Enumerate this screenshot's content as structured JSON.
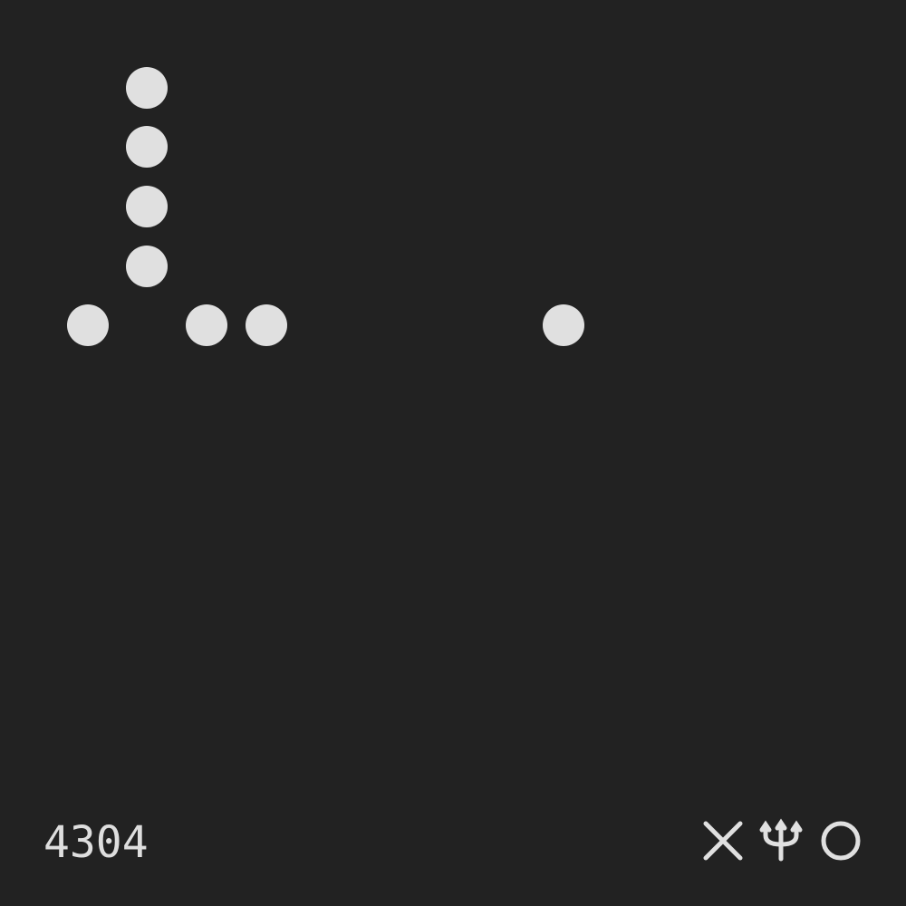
{
  "code": "4304",
  "colors": {
    "background": "#222222",
    "foreground": "#e0e0e0"
  },
  "dot_grid": {
    "rows": 15,
    "cols": 15,
    "dots": [
      {
        "row": 1,
        "col": 2
      },
      {
        "row": 2,
        "col": 2
      },
      {
        "row": 3,
        "col": 2
      },
      {
        "row": 4,
        "col": 2
      },
      {
        "row": 5,
        "col": 1
      },
      {
        "row": 5,
        "col": 3
      },
      {
        "row": 5,
        "col": 4
      },
      {
        "row": 5,
        "col": 9
      }
    ]
  },
  "symbols": [
    "cross-icon",
    "trident-icon",
    "ring-icon"
  ]
}
